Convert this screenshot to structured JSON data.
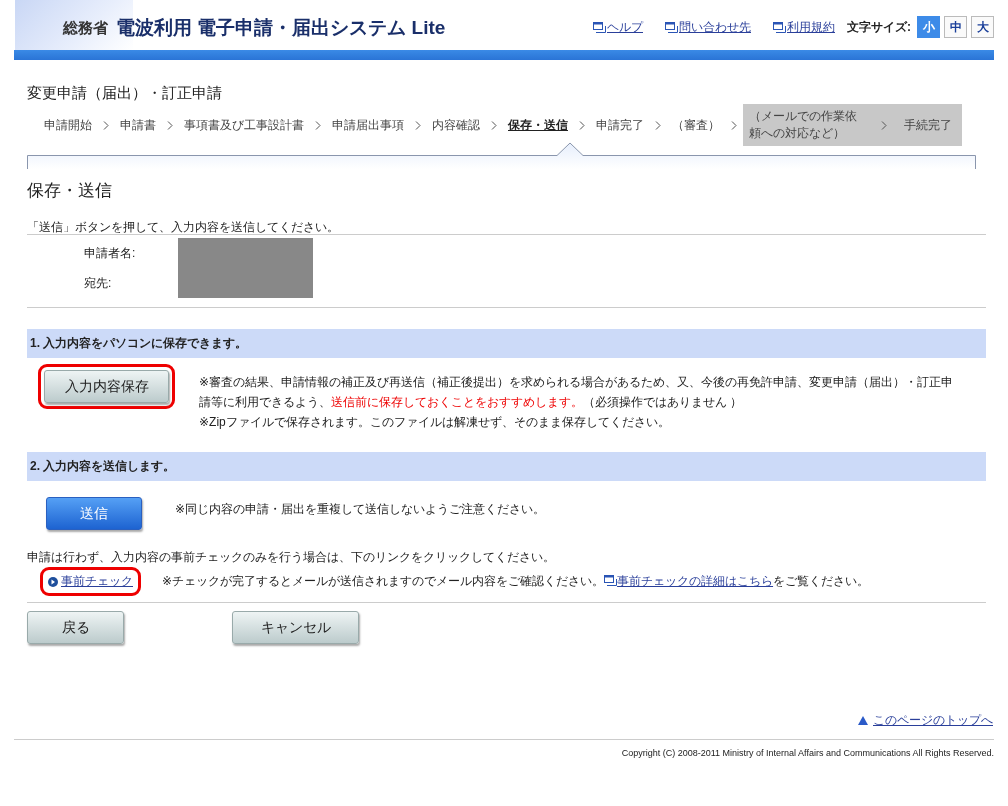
{
  "header": {
    "ministry": "総務省",
    "system_title": "電波利用 電子申請・届出システム Lite",
    "links": [
      "ヘルプ",
      "問い合わせ先",
      "利用規約"
    ],
    "font_size_label": "文字サイズ:",
    "font_sizes": [
      {
        "label": "小",
        "selected": true
      },
      {
        "label": "中",
        "selected": false
      },
      {
        "label": "大",
        "selected": false
      }
    ]
  },
  "page_title": "変更申請（届出）・訂正申請",
  "steps": [
    {
      "label": "申請開始",
      "selected": false,
      "kind": "plain"
    },
    {
      "label": "申請書",
      "selected": false,
      "kind": "plain"
    },
    {
      "label": "事項書及び工事設計書",
      "selected": false,
      "kind": "plain"
    },
    {
      "label": "申請届出事項",
      "selected": false,
      "kind": "plain"
    },
    {
      "label": "内容確認",
      "selected": false,
      "kind": "plain"
    },
    {
      "label": "保存・送信",
      "selected": true,
      "kind": "plain"
    },
    {
      "label": "申請完了",
      "selected": false,
      "kind": "plain"
    },
    {
      "label": "（審査）",
      "selected": false,
      "kind": "plain"
    },
    {
      "label": "（メールでの作業依頼への対応など）",
      "selected": false,
      "kind": "shaded"
    },
    {
      "label": "手続完了",
      "selected": false,
      "kind": "shaded"
    }
  ],
  "section_title": "保存・送信",
  "intro": "「送信」ボタンを押して、入力内容を送信してください。",
  "applicant_fields": [
    {
      "label": "申請者名:"
    },
    {
      "label": "宛先:"
    }
  ],
  "save_section": {
    "heading": "1. 入力内容をパソコンに保存できます。",
    "button": {
      "label": "入力内容保存",
      "highlighted": true
    },
    "note": {
      "before": "※審査の結果、申請情報の補正及び再送信（補正後提出）を求められる場合があるため、又、今後の再免許申請、変更申請（届出）・訂正申請等に利用できるよう、",
      "emphasis": "送信前に保存しておくことをおすすめします。",
      "after": "（必須操作ではありません ）"
    },
    "note_2": "※Zipファイルで保存されます。このファイルは解凍せず、そのまま保存してください。"
  },
  "send_section": {
    "heading": "2. 入力内容を送信します。",
    "button": {
      "label": "送信"
    },
    "note": "※同じ内容の申請・届出を重複して送信しないようご注意ください。",
    "instruction": "申請は行わず、入力内容の事前チェックのみを行う場合は、下のリンクをクリックしてください。",
    "precheck_link": {
      "label": "事前チェック",
      "highlighted": true
    },
    "precheck_note": {
      "before": "※チェックが完了するとメールが送信されますのでメール内容をご確認ください。",
      "link": "事前チェックの詳細はこちら",
      "after": "をご覧ください。"
    }
  },
  "bottom_buttons": [
    "戻る",
    "キャンセル"
  ],
  "page_top_link": "このページのトップへ",
  "copyright": "Copyright (C) 2008-2011 Ministry of Internal Affairs and Communications All Rights Reserved."
}
